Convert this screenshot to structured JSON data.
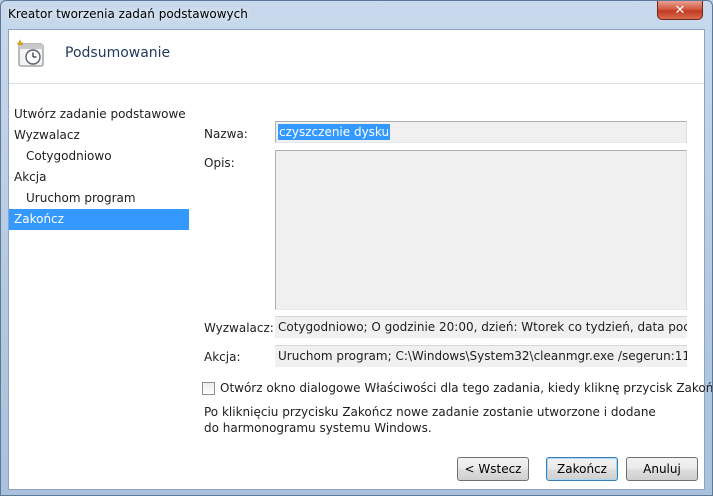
{
  "window": {
    "title": "Kreator tworzenia zadań podstawowych",
    "close_glyph": "✕"
  },
  "header": {
    "title": "Podsumowanie",
    "icon": "task-clock-icon"
  },
  "steps": [
    {
      "label": "Utwórz zadanie podstawowe",
      "sub": false,
      "active": false
    },
    {
      "label": "Wyzwalacz",
      "sub": false,
      "active": false
    },
    {
      "label": "Cotygodniowo",
      "sub": true,
      "active": false
    },
    {
      "label": "Akcja",
      "sub": false,
      "active": false
    },
    {
      "label": "Uruchom program",
      "sub": true,
      "active": false
    },
    {
      "label": "Zakończ",
      "sub": false,
      "active": true
    }
  ],
  "form": {
    "name_label": "Nazwa:",
    "name_value": "czyszczenie dysku",
    "desc_label": "Opis:",
    "desc_value": "",
    "trigger_label": "Wyzwalacz:",
    "trigger_value": "Cotygodniowo; O godzinie 20:00, dzień: Wtorek co tydzień, data początkowa:",
    "action_label": "Akcja:",
    "action_value": "Uruchom program; C:\\Windows\\System32\\cleanmgr.exe /segerun:11"
  },
  "options": {
    "open_properties_label": "Otwórz okno dialogowe Właściwości dla tego zadania, kiedy kliknę przycisk Zakończ",
    "open_properties_checked": false,
    "note": "Po kliknięciu przycisku Zakończ nowe zadanie zostanie utworzone i dodane do harmonogramu systemu Windows."
  },
  "buttons": {
    "back": "< Wstecz",
    "finish": "Zakończ",
    "cancel": "Anuluj"
  },
  "colors": {
    "selection": "#3399ff",
    "header_title": "#1e395b"
  }
}
